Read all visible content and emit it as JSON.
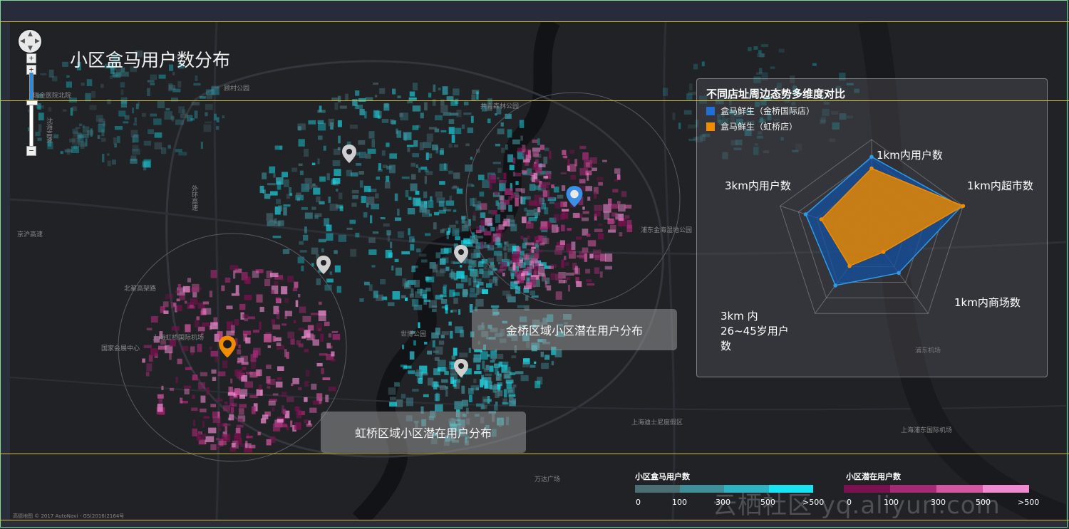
{
  "title": "小区盒马用户数分布",
  "callouts": {
    "jinqiao": "金桥区域小区潜在用户分布",
    "hongqiao": "虹桥区域小区潜在用户分布"
  },
  "panel": {
    "title": "不同店址周边态势多维度对比",
    "legend": [
      {
        "name": "盒马鲜生（金桥国际店）",
        "color": "#1f6fd6"
      },
      {
        "name": "盒马鲜生（虹桥店）",
        "color": "#f08c00"
      }
    ]
  },
  "colors": {
    "users_scale": [
      "#4a6e74",
      "#3e8f99",
      "#2fb3c2",
      "#17e3f2"
    ],
    "potential_scale": [
      "#7b1150",
      "#a52a74",
      "#d2579f",
      "#f08ad0"
    ],
    "pin_gray": "#cfcfcf",
    "pin_blue": "#3a8fe6",
    "pin_orange": "#f08c00"
  },
  "chart_data": {
    "type": "radar",
    "title": "不同店址周边态势多维度对比",
    "axes": [
      "1km内用户数",
      "1km内超市数",
      "1km内商场数",
      "3km 内26~45岁用户数",
      "3km内用户数"
    ],
    "max": 100,
    "series": [
      {
        "name": "盒马鲜生（金桥国际店）",
        "values": [
          82,
          98,
          48,
          64,
          72
        ]
      },
      {
        "name": "盒马鲜生（虹桥店）",
        "values": [
          70,
          100,
          21,
          39,
          55
        ]
      }
    ]
  },
  "scales": {
    "users": {
      "title": "小区盒马用户数",
      "ticks": [
        "0",
        "100",
        "300",
        "500",
        ">500"
      ]
    },
    "potential": {
      "title": "小区潜在用户数",
      "ticks": [
        "0",
        "100",
        "300",
        "500",
        ">500"
      ]
    }
  },
  "map_labels": {
    "l1": "瑞金医院北院",
    "l2": "顾村公园",
    "l3": "沈海高速",
    "l4": "外环高速",
    "l5": "京沪高速",
    "l6": "北翟高架路",
    "l7": "上海虹桥国际机场",
    "l8": "国家会展中心",
    "l9": "上海迪士尼度假区",
    "l10": "上海浦东国际机场",
    "l11": "浦东金海湿地公园",
    "l12": "共青森林公园",
    "l13": "世博公园",
    "l14": "浦东机场",
    "l15": "万达广场"
  },
  "watermark": "云栖社区 yq.aliyun.com",
  "attribution": "高德地图 © 2017 AutoNavi - GS(2016)2164号"
}
